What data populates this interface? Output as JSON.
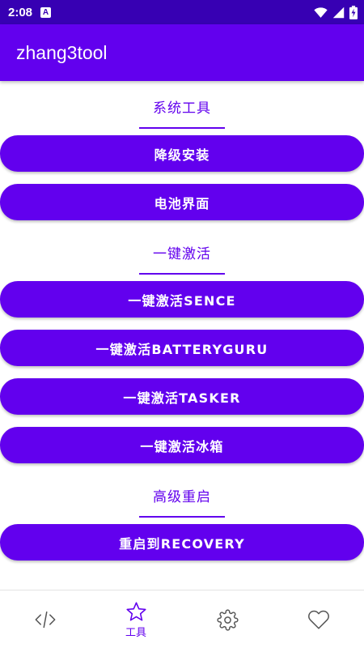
{
  "status_bar": {
    "time": "2:08",
    "app_icon_letter": "A"
  },
  "app_bar": {
    "title": "zhang3tool"
  },
  "sections": {
    "system": {
      "title": "系统工具"
    },
    "activate": {
      "title": "一键激活"
    },
    "reboot": {
      "title": "高级重启"
    }
  },
  "buttons": {
    "downgrade": "降级安装",
    "battery": "电池界面",
    "sence": "一键激活SENCE",
    "batteryguru": "一键激活BATTERYGURU",
    "tasker": "一键激活TASKER",
    "icebox": "一键激活冰箱",
    "recovery": "重启到RECOVERY"
  },
  "bottom_nav": {
    "items": [
      {
        "icon": "code-icon",
        "label": ""
      },
      {
        "icon": "star-icon",
        "label": "工具",
        "active": true
      },
      {
        "icon": "gear-icon",
        "label": ""
      },
      {
        "icon": "heart-icon",
        "label": ""
      }
    ]
  },
  "colors": {
    "primary": "#6200ee",
    "primary_dark": "#3700b3",
    "inactive_icon": "#555555"
  }
}
